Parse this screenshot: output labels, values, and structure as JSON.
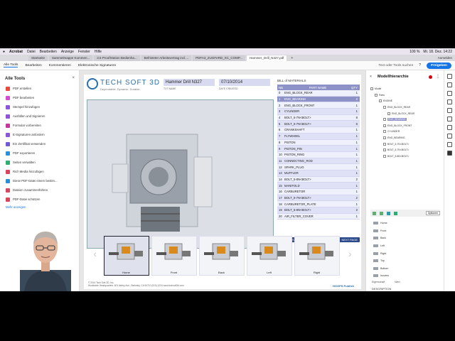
{
  "menubar": {
    "apple": "",
    "app": "Acrobat",
    "items": [
      "Datei",
      "Bearbeiten",
      "Anzeige",
      "Fenster",
      "Hilfe"
    ],
    "clock": "Mi. 18. Dez. 14:22",
    "battery": "100 %"
  },
  "tabs": [
    {
      "label": "Startseite",
      "active": false
    },
    {
      "label": "Sammelmappe Kommen...",
      "active": false
    },
    {
      "label": "3.5 ProofStation Bedienha...",
      "active": false
    },
    {
      "label": "Befristeter Arbeitsvertrag incl....",
      "active": false
    },
    {
      "label": "PDFA3_ZUGFeRD_XC_COMP...",
      "active": false
    },
    {
      "label": "Hammer_Drill_N327.pdf",
      "active": true
    }
  ],
  "tabbar": {
    "new_tab": "+",
    "sign_in": "Anmelden"
  },
  "toolbar": {
    "items": [
      {
        "label": "Alle Tools",
        "selected": true
      },
      {
        "label": "Bearbeiten",
        "selected": false
      },
      {
        "label": "Kommentieren",
        "selected": false
      },
      {
        "label": "Elektronische Signaturen",
        "selected": false
      }
    ],
    "search_placeholder": "Text oder Tools suchen",
    "share": "Freigeben"
  },
  "left_tools": {
    "title": "Alle Tools",
    "close": "×",
    "items": [
      {
        "label": "PDF erstellen",
        "color": "#e84b3c"
      },
      {
        "label": "PDF bearbeiten",
        "color": "#d24bd0"
      },
      {
        "label": "Stempel hinzufügen",
        "color": "#8d56d6"
      },
      {
        "label": "Ausfüllen und Signieren",
        "color": "#8d56d6"
      },
      {
        "label": "Formular vorbereiten",
        "color": "#c0399b"
      },
      {
        "label": "E-Signaturen anfordern",
        "color": "#8d56d6"
      },
      {
        "label": "Ein Zertifikat verwenden",
        "color": "#6f5bd6"
      },
      {
        "label": "PDF exportieren",
        "color": "#2c8fd6"
      },
      {
        "label": "Seiten verwalten",
        "color": "#2fae72"
      },
      {
        "label": "Rich Media hinzufügen",
        "color": "#d6475c"
      },
      {
        "label": "Diese PDF-Datei einem bestim...",
        "color": "#2c8fd6"
      },
      {
        "label": "Dateien zusammenführen",
        "color": "#d6475c"
      },
      {
        "label": "PDF-Datei schützen",
        "color": "#d6475c"
      }
    ],
    "more": "Mehr anzeigen"
  },
  "document": {
    "logo_name": "TECH SOFT 3D",
    "logo_tag": "Dependable. Dynamic. Durable.",
    "title_value": "Hammer Drill N327",
    "title_label": "TXT NAME",
    "date_value": "07/10/2014",
    "date_label": "DATE CREATED",
    "bom": {
      "title": "BILL of MATERIALS",
      "headers": [
        "NB",
        "PART NAME",
        "QTY"
      ],
      "rows": [
        {
          "nb": "0",
          "name": "ENG_BLOCK_REAR",
          "qty": "1",
          "hl": false
        },
        {
          "nb": "1",
          "name": "ENG_BEARING",
          "qty": "2",
          "hl": true
        },
        {
          "nb": "2",
          "name": "ENG_BLOCK_FRONT",
          "qty": "1",
          "hl": false
        },
        {
          "nb": "3",
          "name": "CYLINDER",
          "qty": "1",
          "hl": false
        },
        {
          "nb": "4",
          "name": "BOLT_5-7N<BOLT>",
          "qty": "8",
          "hl": false
        },
        {
          "nb": "5",
          "name": "BOLT_5-7N<BOLT>",
          "qty": "6",
          "hl": false
        },
        {
          "nb": "6",
          "name": "CRANKSHAFT",
          "qty": "1",
          "hl": false
        },
        {
          "nb": "7",
          "name": "FLYWHEEL",
          "qty": "1",
          "hl": false
        },
        {
          "nb": "8",
          "name": "PISTON",
          "qty": "1",
          "hl": false
        },
        {
          "nb": "9",
          "name": "PISTON_PIN",
          "qty": "1",
          "hl": false
        },
        {
          "nb": "10",
          "name": "PISTON_RING",
          "qty": "1",
          "hl": false
        },
        {
          "nb": "11",
          "name": "CONNECTING_ROD",
          "qty": "1",
          "hl": false
        },
        {
          "nb": "12",
          "name": "SPARK_PLUG",
          "qty": "1",
          "hl": false
        },
        {
          "nb": "13",
          "name": "MUFFLER",
          "qty": "1",
          "hl": false
        },
        {
          "nb": "14",
          "name": "BOLT_5-8N<BOLT>",
          "qty": "2",
          "hl": false
        },
        {
          "nb": "15",
          "name": "MANIFOLD",
          "qty": "1",
          "hl": false
        },
        {
          "nb": "16",
          "name": "CARBURETOR",
          "qty": "1",
          "hl": false
        },
        {
          "nb": "17",
          "name": "BOLT_5-7N<BOLT>",
          "qty": "2",
          "hl": false
        },
        {
          "nb": "18",
          "name": "CARBURETOR_PLATE",
          "qty": "1",
          "hl": false
        },
        {
          "nb": "19",
          "name": "BOLT_5-8N<BOLT>",
          "qty": "2",
          "hl": false
        },
        {
          "nb": "20",
          "name": "AIR_FILTER_COVER",
          "qty": "1",
          "hl": false
        }
      ],
      "prev": "PREVIOUS PAGE",
      "page": "1 / 3",
      "next": "NEXT PAGE"
    },
    "thumbs": [
      {
        "caption": "Home",
        "selected": true
      },
      {
        "caption": "Front",
        "selected": false
      },
      {
        "caption": "Back",
        "selected": false
      },
      {
        "caption": "Left",
        "selected": false
      },
      {
        "caption": "Right",
        "selected": false
      }
    ],
    "footer_line1": "© 2014 Tech Soft 3D, Inc.",
    "footer_line2": "Worldwide Headquarters: 801 Ashby Ave., Berkeley, CA 94710 (510) 1234   www.techsoft3d.com",
    "footer_badge": "HOOPS Publish"
  },
  "model_tree": {
    "title": "Modellhierarchie",
    "close": "×",
    "more": "⋮",
    "nodes": [
      {
        "label": "Model",
        "indent": 0,
        "hl": false
      },
      {
        "label": "Parts",
        "indent": 1,
        "hl": false
      },
      {
        "label": "ENGINE",
        "indent": 2,
        "hl": false
      },
      {
        "label": "ENG_BLOCK_REAR",
        "indent": 3,
        "hl": false
      },
      {
        "label": "ENG_BLOCK_REAR",
        "indent": 4,
        "hl": false
      },
      {
        "label": "ENG_BEARING",
        "indent": 3,
        "hl": true
      },
      {
        "label": "ENG_BLOCK_FRONT",
        "indent": 3,
        "hl": false
      },
      {
        "label": "CYLINDER",
        "indent": 3,
        "hl": false
      },
      {
        "label": "ENG_BEARING",
        "indent": 3,
        "hl": false
      },
      {
        "label": "BOLT_5-7N<BOLT>",
        "indent": 3,
        "hl": false
      },
      {
        "label": "BOLT_5-7N<BOLT>",
        "indent": 3,
        "hl": false
      },
      {
        "label": "BOLT_5-8N<BOLT>",
        "indent": 3,
        "hl": false
      }
    ],
    "options_label": "Optionen",
    "views": [
      "Home",
      "Front",
      "Back",
      "Left",
      "Right",
      "Top",
      "Bottom",
      "Isoview"
    ],
    "props_headers": [
      "Eigenschaft",
      "Wert"
    ],
    "props": [
      "DESCRIPTION",
      "MODELED_BY"
    ]
  },
  "colors": {
    "accent": "#1473e6",
    "bom_header": "#8d92c6",
    "brand": "#2a6fad"
  }
}
